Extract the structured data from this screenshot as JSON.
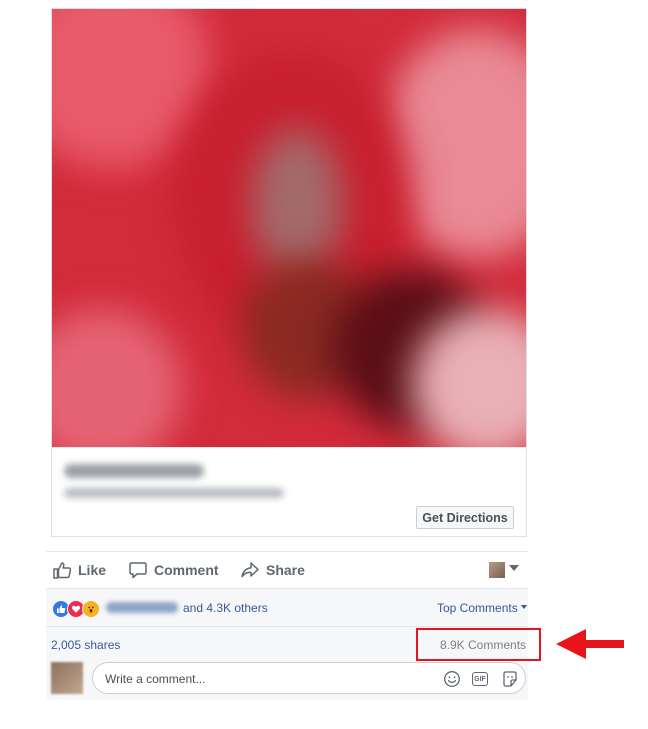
{
  "link_card": {
    "cta_label": "Get Directions"
  },
  "actions": {
    "like_label": "Like",
    "comment_label": "Comment",
    "share_label": "Share"
  },
  "reactions": {
    "icons": [
      "like-reaction",
      "love-reaction",
      "wow-reaction"
    ],
    "others_text": "and 4.3K others",
    "sort_label": "Top Comments"
  },
  "stats": {
    "shares": "2,005 shares",
    "comments": "8.9K Comments"
  },
  "composer": {
    "placeholder": "Write a comment...",
    "icons": [
      "emoji-icon",
      "gif-icon",
      "sticker-icon"
    ]
  },
  "colors": {
    "link": "#365899",
    "highlight": "#e8141b",
    "photo_red": "#d22b3a"
  }
}
